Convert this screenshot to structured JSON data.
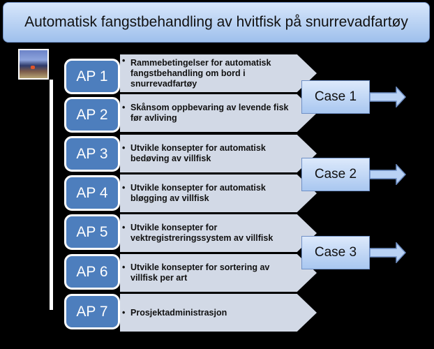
{
  "title": "Automatisk fangstbehandling av hvitfisk på snurrevadfartøy",
  "photo": {
    "alt": "Fishing vessel deck"
  },
  "work_packages": [
    {
      "label": "AP 1",
      "description": "Rammebetingelser for automatisk fangstbehandling om bord i snurrevadfartøy"
    },
    {
      "label": "AP 2",
      "description": "Skånsom oppbevaring av levende fisk før avliving"
    },
    {
      "label": "AP 3",
      "description": "Utvikle konsepter for automatisk bedøving av villfisk"
    },
    {
      "label": "AP 4",
      "description": "Utvikle konsepter for automatisk bløgging av villfisk"
    },
    {
      "label": "AP 5",
      "description": "Utvikle konsepter for vektregistreringssystem av villfisk"
    },
    {
      "label": "AP 6",
      "description": "Utvikle konsepter for sortering av villfisk per art"
    },
    {
      "label": "AP 7",
      "description": "Prosjektadministrasjon"
    }
  ],
  "cases": [
    {
      "label": "Case 1"
    },
    {
      "label": "Case 2"
    },
    {
      "label": "Case 3"
    }
  ],
  "bullet": "•",
  "colors": {
    "ap_fill": "#4d7ebd",
    "desc_fill": "#d2d9e6",
    "case_fill_top": "#dce9fb",
    "case_fill_bottom": "#a9c7f0"
  }
}
